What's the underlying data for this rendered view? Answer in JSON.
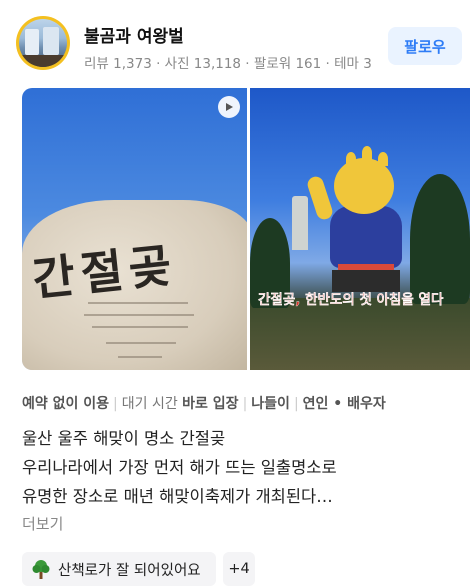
{
  "header": {
    "user_name": "불곰과 여왕벌",
    "stats": "리뷰 1,373 · 사진 13,118 · 팔로워 161 · 테마 3",
    "follow_label": "팔로우"
  },
  "photos": {
    "photo1_engraving": "간절곶",
    "photo2_overlay": "간절곶, 한반도의 첫 아침을 열다"
  },
  "tags": [
    {
      "bold": "예약 없이 이용",
      "prefix": ""
    },
    {
      "bold": "바로 입장",
      "prefix": "대기 시간 "
    },
    {
      "bold": "나들이",
      "prefix": ""
    },
    {
      "bold": "연인 • 배우자",
      "prefix": ""
    }
  ],
  "review": {
    "line1": "울산 울주 해맞이 명소 간절곶",
    "line2": "우리나라에서 가장 먼저 해가 뜨는 일출명소로",
    "line3": "유명한 장소로 매년 해맞이축제가 개최된다…",
    "more_label": "더보기"
  },
  "keywords": {
    "chip1_label": "산책로가 잘 되어있어요",
    "chip1_icon": "tree-icon",
    "chip2_label": "+4"
  },
  "colors": {
    "follow_text": "#2e7cf6",
    "follow_bg": "#eaf3ff",
    "avatar_ring": "#f4c020"
  }
}
